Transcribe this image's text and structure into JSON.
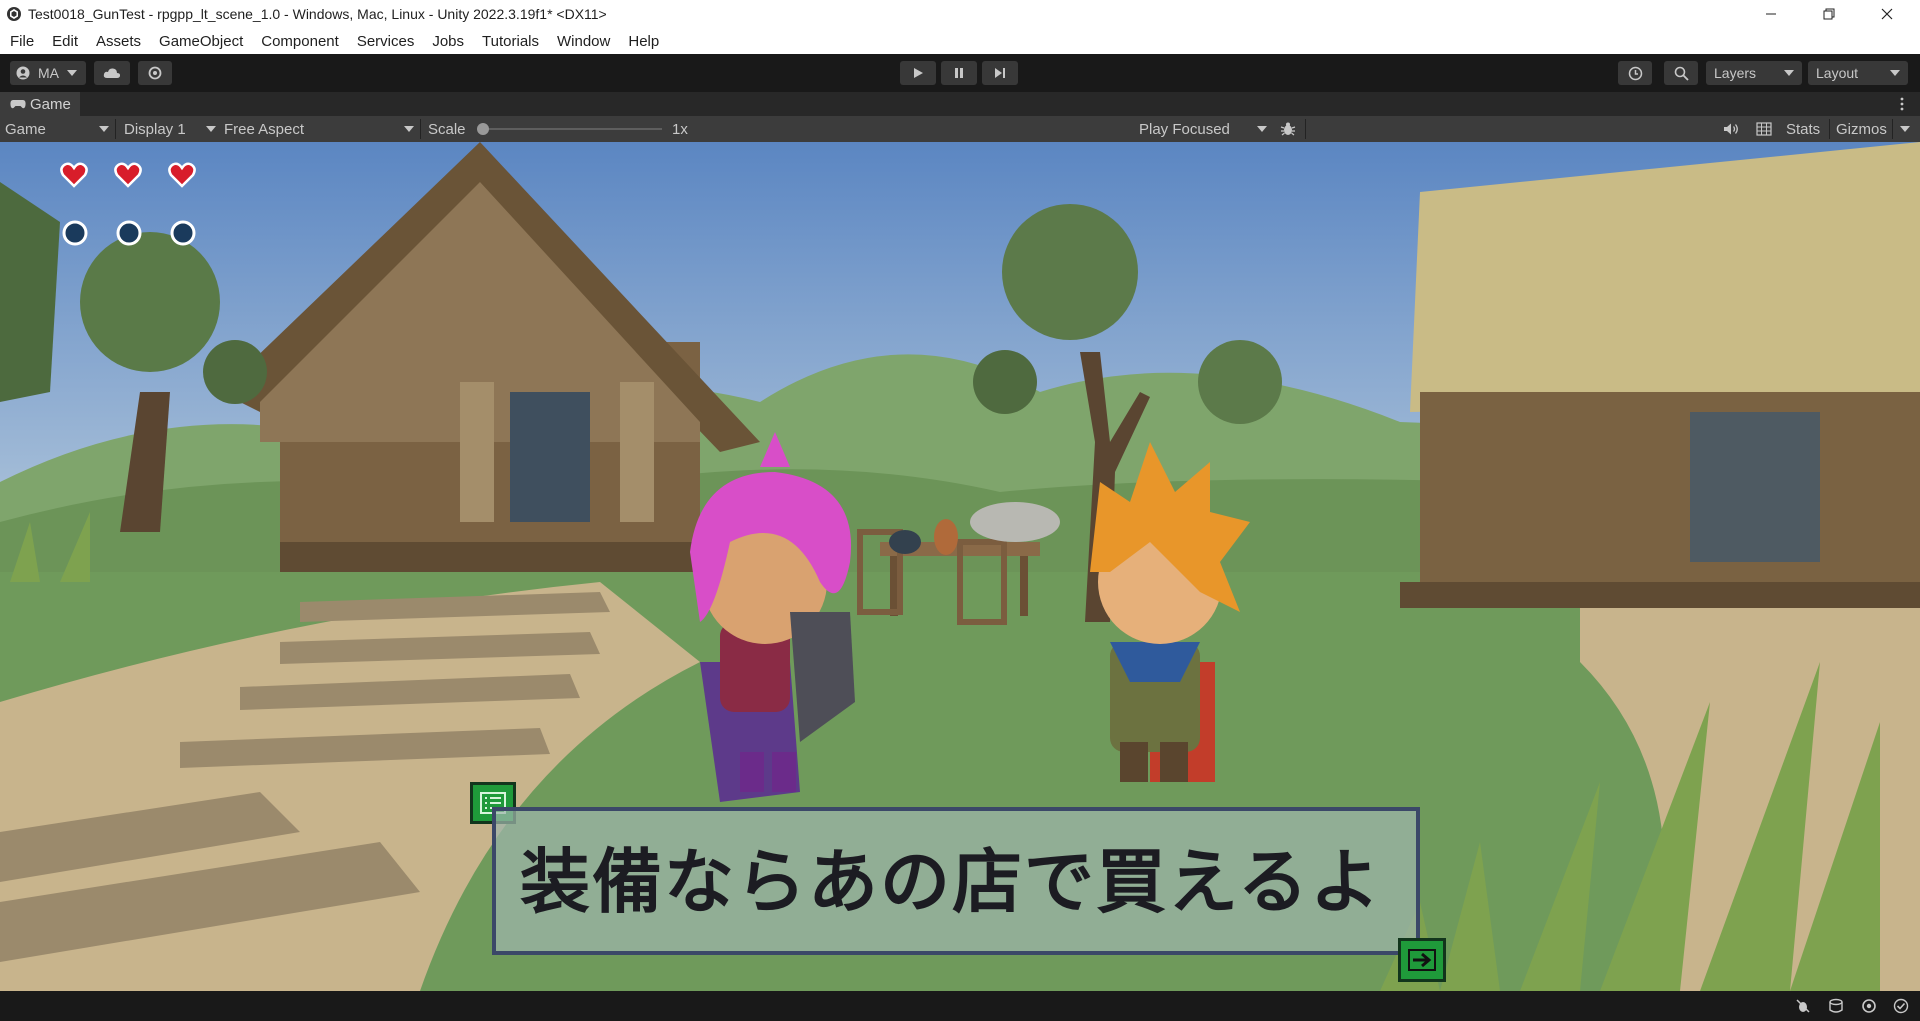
{
  "window": {
    "title": "Test0018_GunTest - rpgpp_lt_scene_1.0 - Windows, Mac, Linux - Unity 2022.3.19f1* <DX11>"
  },
  "menu": [
    "File",
    "Edit",
    "Assets",
    "GameObject",
    "Component",
    "Services",
    "Jobs",
    "Tutorials",
    "Window",
    "Help"
  ],
  "toolbar": {
    "account_label": "MA",
    "layers_label": "Layers",
    "layout_label": "Layout"
  },
  "tab": {
    "label": "Game"
  },
  "game_toolbar": {
    "view_select": "Game",
    "display_select": "Display 1",
    "aspect_select": "Free Aspect",
    "scale_label": "Scale",
    "scale_value": "1x",
    "play_mode_select": "Play Focused",
    "stats_label": "Stats",
    "gizmos_label": "Gizmos"
  },
  "hud": {
    "hearts": 3,
    "orbs": 3,
    "heart_color": "#d81d2a",
    "orb_color": "#1a3a5c"
  },
  "dialog": {
    "text": "装備ならあの店で買えるよ",
    "box_color": "#9eb5ac",
    "border_color": "#3b4868",
    "icon_color": "#1f9a3a"
  },
  "colors": {
    "sky_top": "#5b86c2",
    "sky_bottom": "#b3c8dc",
    "grass": "#6f9a5b",
    "path": "#c8b48c"
  }
}
